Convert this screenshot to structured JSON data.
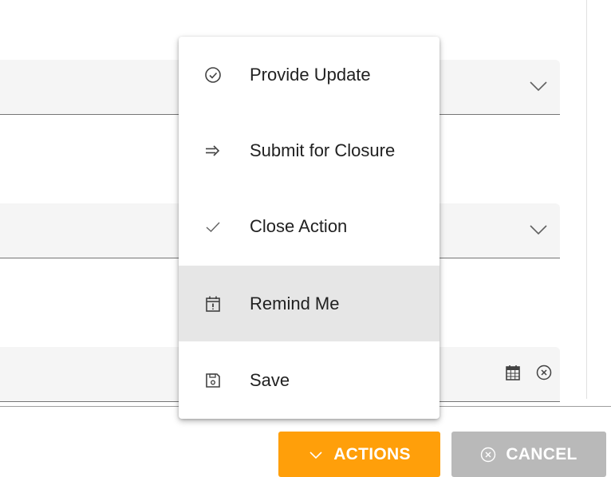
{
  "form": {
    "fields": [
      {
        "value": ""
      },
      {
        "value": ""
      },
      {
        "value": ""
      }
    ]
  },
  "menu": {
    "items": [
      {
        "label": "Provide Update",
        "icon": "check-circle-icon"
      },
      {
        "label": "Submit for Closure",
        "icon": "arrow-right-icon"
      },
      {
        "label": "Close Action",
        "icon": "check-icon"
      },
      {
        "label": "Remind Me",
        "icon": "calendar-alert-icon",
        "highlighted": true
      },
      {
        "label": "Save",
        "icon": "save-icon"
      }
    ]
  },
  "buttons": {
    "actions_label": "ACTIONS",
    "cancel_label": "CANCEL"
  },
  "colors": {
    "accent": "#ff9f0a",
    "disabled": "#b9b9b9",
    "hover": "#e6e6e6"
  }
}
